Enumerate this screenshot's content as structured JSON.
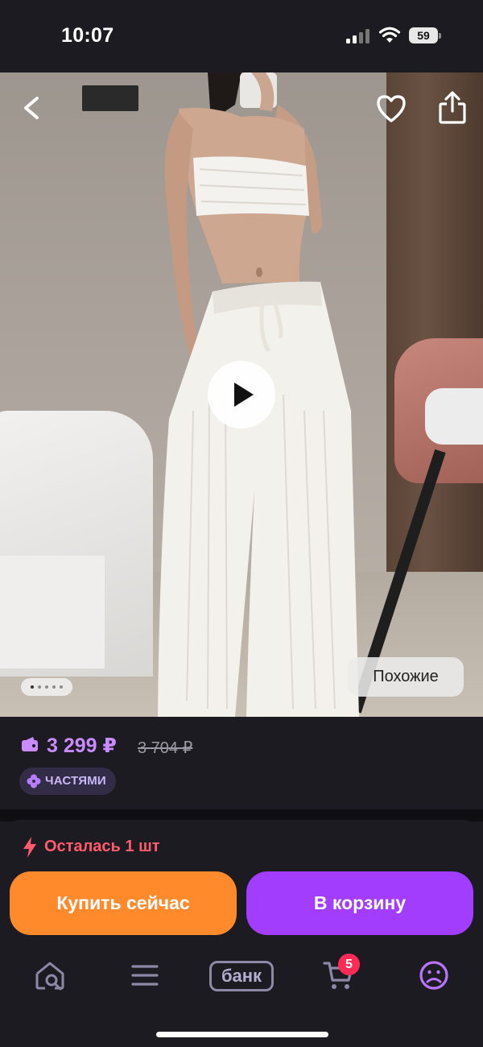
{
  "status_bar": {
    "time": "10:07",
    "battery": "59",
    "icons": [
      "signal-icon",
      "wifi-icon",
      "battery-icon"
    ]
  },
  "product_media": {
    "nav_icons": [
      "chevron-left-icon",
      "heart-icon",
      "share-icon"
    ],
    "play_icon": "play-icon",
    "gallery_count": 5,
    "gallery_active": 1,
    "similar_label": "Похожие"
  },
  "price": {
    "current": "3 299 ₽",
    "old": "3 704 ₽",
    "wallet_icon": "wallet-icon",
    "installments_badge": "ЧАСТЯМИ",
    "installments_icon": "clover-icon"
  },
  "purchase": {
    "stock_icon": "lightning-icon",
    "stock_text": "Осталась 1 шт",
    "buy_now_label": "Купить сейчас",
    "add_to_cart_label": "В корзину"
  },
  "tab_bar": {
    "items": [
      {
        "name": "home",
        "icon": "home-search-icon"
      },
      {
        "name": "catalog",
        "icon": "menu-icon"
      },
      {
        "name": "bank",
        "label": "банк"
      },
      {
        "name": "cart",
        "icon": "cart-icon",
        "badge": "5"
      },
      {
        "name": "profile",
        "icon": "profile-icon"
      }
    ]
  },
  "colors": {
    "background": "#1c1b21",
    "price_accent": "#c98bff",
    "buy_now": "#ff8a2b",
    "add_to_cart": "#a33dfd",
    "stock_warning": "#ff5b6c",
    "cart_badge": "#ff2a55"
  }
}
